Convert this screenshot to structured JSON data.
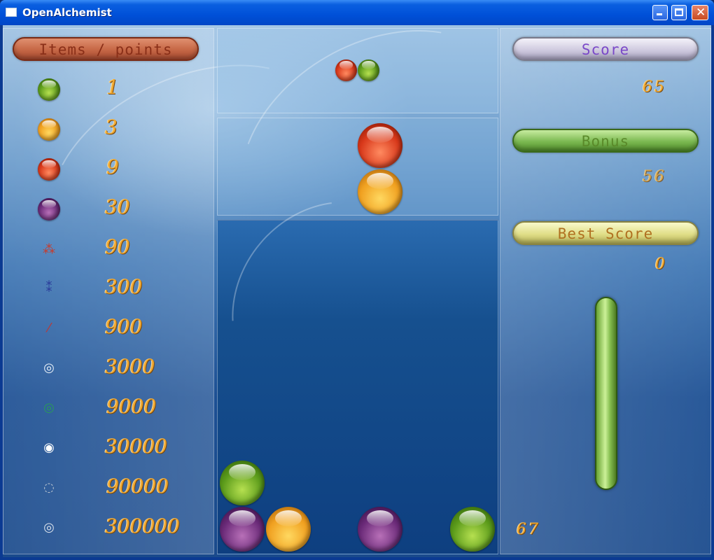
{
  "window": {
    "title": "OpenAlchemist"
  },
  "left_panel": {
    "header": "Items / points",
    "items": [
      {
        "icon": "green-ball-icon",
        "points": "1"
      },
      {
        "icon": "yellow-ball-icon",
        "points": "3"
      },
      {
        "icon": "red-ball-icon",
        "points": "9"
      },
      {
        "icon": "purple-ball-icon",
        "points": "30"
      },
      {
        "icon": "red-molecule-icon",
        "points": "90"
      },
      {
        "icon": "blue-molecule-icon",
        "points": "300"
      },
      {
        "icon": "red-crystal-icon",
        "points": "900"
      },
      {
        "icon": "white-ring-icon",
        "points": "3000"
      },
      {
        "icon": "green-ring-icon",
        "points": "9000"
      },
      {
        "icon": "spiral-icon",
        "points": "30000"
      },
      {
        "icon": "grey-ring-icon",
        "points": "90000"
      },
      {
        "icon": "silver-ring-icon",
        "points": "300000"
      }
    ]
  },
  "right_panel": {
    "score_label": "Score",
    "score_value": "65",
    "bonus_label": "Bonus",
    "bonus_value": "56",
    "best_label": "Best Score",
    "best_value": "0",
    "bottom_value": "67"
  },
  "game": {
    "next_piece": [
      "red",
      "green"
    ],
    "current_piece": [
      "red",
      "yellow"
    ],
    "board_bottom_row": [
      "purple",
      "yellow",
      "empty",
      "purple",
      "empty",
      "green"
    ],
    "board_second_row": [
      "green",
      "empty",
      "empty",
      "empty",
      "empty",
      "empty"
    ]
  },
  "colors": {
    "points_text": "#f0a830",
    "background": "#1c4f93"
  }
}
